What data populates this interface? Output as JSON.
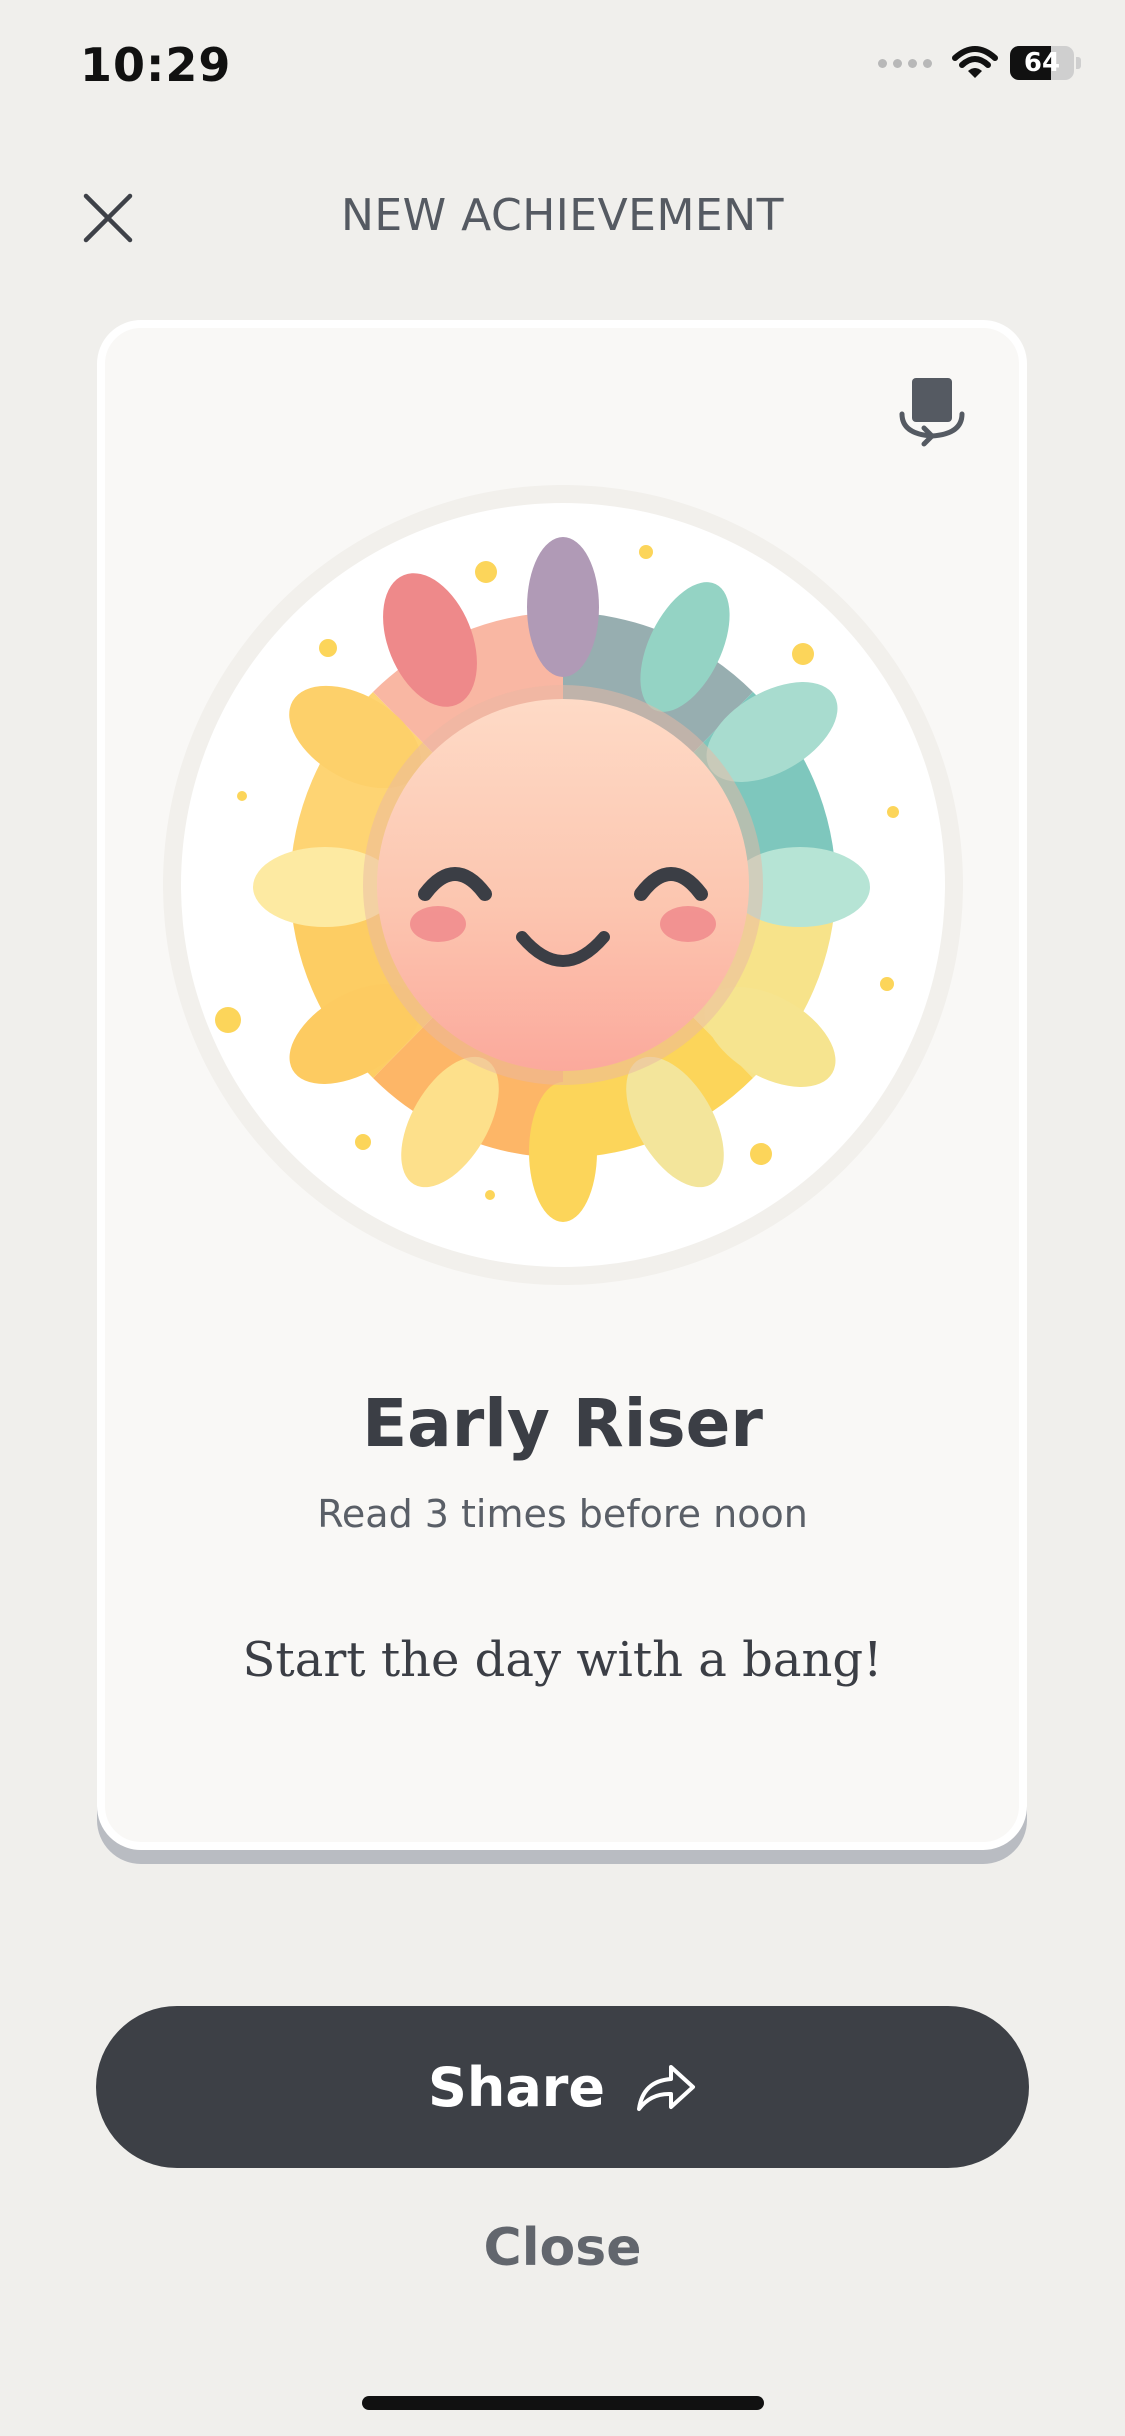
{
  "status_bar": {
    "time": "10:29",
    "battery_level": "64",
    "battery_percent": 64,
    "icons": [
      "cellular-signal-icon",
      "wifi-icon",
      "battery-icon"
    ]
  },
  "header": {
    "title": "NEW ACHIEVEMENT",
    "close_icon": "close-icon"
  },
  "card": {
    "flip_icon": "card-flip-icon",
    "badge_icon": "smiling-sun-badge",
    "title": "Early Riser",
    "subtitle": "Read 3 times before noon",
    "tagline": "Start the day with a bang!"
  },
  "actions": {
    "share_label": "Share",
    "share_icon": "share-arrow-icon",
    "close_label": "Close"
  },
  "colors": {
    "background": "#f0efec",
    "card": "#f9f8f6",
    "primary_button": "#3d4046",
    "text_dark": "#3b3e45",
    "text_muted": "#5a5f67"
  }
}
